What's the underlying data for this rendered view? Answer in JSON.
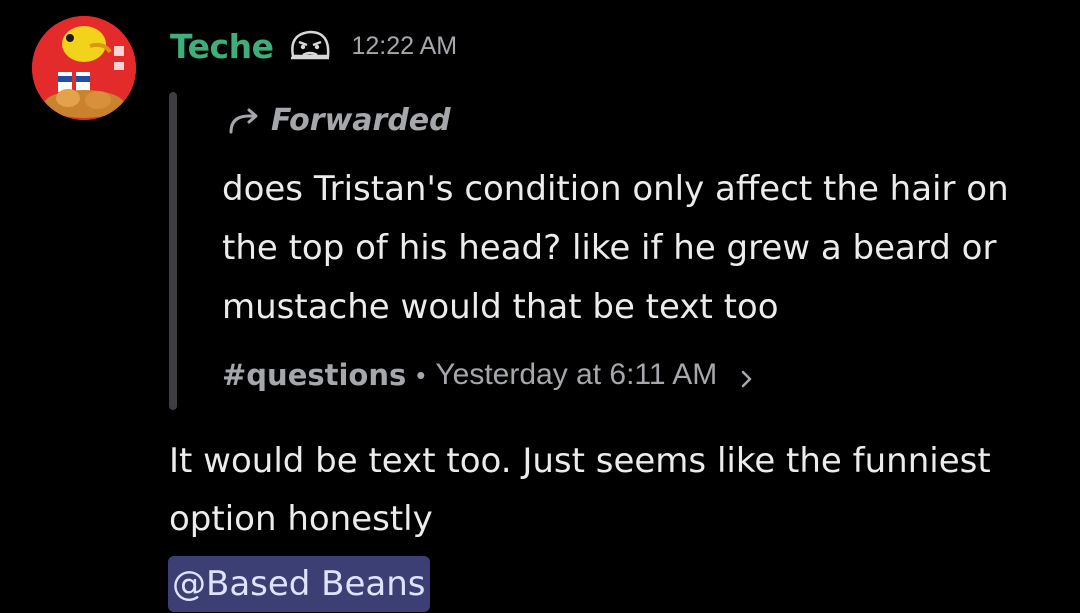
{
  "author": {
    "name": "Teche",
    "timestamp": "12:22 AM",
    "name_color": "#3fae7b",
    "avatar_icon": "fried-chicken-avatar",
    "badge_icon": "grumpy-face-badge"
  },
  "forwarded": {
    "label": "Forwarded",
    "icon": "forward-arrow-icon",
    "text": "does Tristan's condition only affect the hair on the top of his head? like if he grew a beard or mustache would that be text too",
    "channel": "#questions",
    "separator": "•",
    "time": "Yesterday at 6:11 AM"
  },
  "reply": {
    "text": "It would be text too. Just seems like the funniest option honestly"
  },
  "mention": {
    "text": "@Based Beans",
    "color": "#3b3f74"
  }
}
